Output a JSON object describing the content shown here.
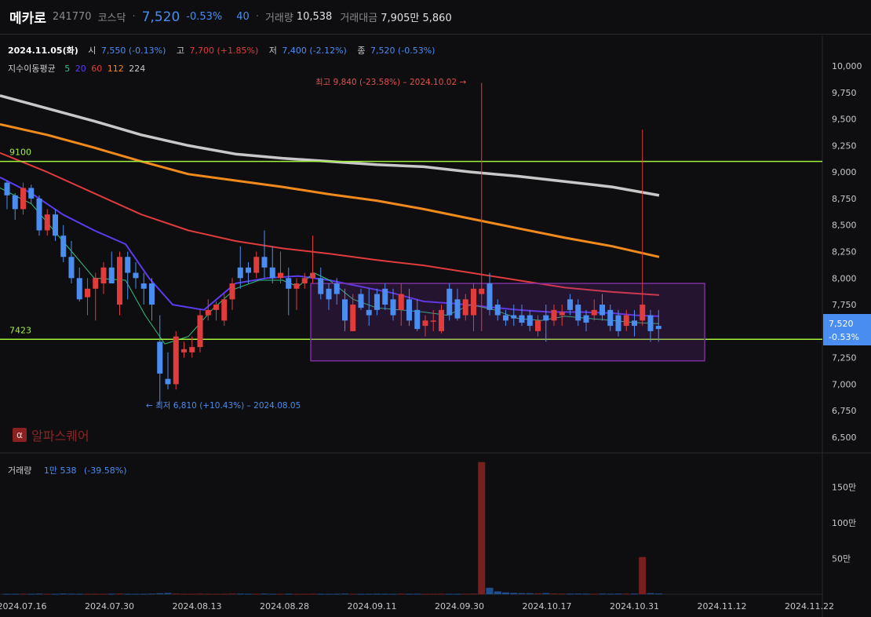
{
  "header": {
    "name": "메카로",
    "code": "241770",
    "market": "코스닥",
    "separator": "·",
    "price": "7,520",
    "change_pct": "-0.53%",
    "change_abs": "40",
    "volume_label": "거래량",
    "volume_value": "10,538",
    "amount_label": "거래대금",
    "amount_value": "7,905만 5,860"
  },
  "ohlc": {
    "date": "2024.11.05(화)",
    "open_label": "시",
    "open_value": "7,550 (-0.13%)",
    "high_label": "고",
    "high_value": "7,700 (+1.85%)",
    "low_label": "저",
    "low_value": "7,400 (-2.12%)",
    "close_label": "종",
    "close_value": "7,520 (-0.53%)"
  },
  "ma_legend": {
    "label": "지수이동평균",
    "periods": [
      "5",
      "20",
      "60",
      "112",
      "224"
    ]
  },
  "volume_info": {
    "label": "거래량",
    "value": "1만 538",
    "change": "(-39.58%)"
  },
  "watermark": {
    "glyph": "α",
    "text": "알파스퀘어"
  },
  "colors": {
    "up": "#e03c3c",
    "down": "#4a8df0",
    "up_volume": "#7a1f1f",
    "down_volume": "#1f4f8f",
    "ma5": "#2ec27e",
    "ma20": "#5b3cf0",
    "ma60": "#e03c3c",
    "ma112": "#f08a1c",
    "ma224": "#c8c8c8",
    "hline": "#a4f03c",
    "box": "#7b2fa0",
    "price_tag": "#4a8df0"
  },
  "chart_data": {
    "type": "candlestick",
    "y_axis_ticks": [
      "10,000",
      "9,750",
      "9,500",
      "9,250",
      "9,000",
      "8,750",
      "8,500",
      "8,250",
      "8,000",
      "7,750",
      "7,500",
      "7,250",
      "7,000",
      "6,750",
      "6,500"
    ],
    "ylim": [
      6400,
      10200
    ],
    "volume_axis_ticks": [
      "150만",
      "100만",
      "50만"
    ],
    "x_axis_ticks": [
      "2024.07.16",
      "2024.07.30",
      "2024.08.13",
      "2024.08.28",
      "2024.09.11",
      "2024.09.30",
      "2024.10.17",
      "2024.10.31",
      "2024.11.12",
      "2024.11.22"
    ],
    "last_price_tag": {
      "price": "7,520",
      "change": "-0.53%"
    },
    "horizontal_lines": [
      {
        "label": "9100",
        "value": 9100
      },
      {
        "label": "7423",
        "value": 7423
      }
    ],
    "annotations": {
      "high": "최고 9,840 (-23.58%) – 2024.10.02 →",
      "low": "← 최저 6,810 (+10.43%) – 2024.08.05"
    },
    "range_box": {
      "price_top": 7950,
      "price_bottom": 7220
    },
    "candles": [
      [
        8900,
        8920,
        8650,
        8780
      ],
      [
        8780,
        8800,
        8550,
        8650
      ],
      [
        8650,
        8900,
        8600,
        8850
      ],
      [
        8850,
        8880,
        8700,
        8750
      ],
      [
        8750,
        8780,
        8400,
        8450
      ],
      [
        8450,
        8650,
        8400,
        8600
      ],
      [
        8600,
        8650,
        8350,
        8400
      ],
      [
        8400,
        8500,
        8150,
        8200
      ],
      [
        8200,
        8350,
        7950,
        8000
      ],
      [
        8000,
        8100,
        7780,
        7800
      ],
      [
        7820,
        8000,
        7650,
        7900
      ],
      [
        7900,
        8050,
        7600,
        8000
      ],
      [
        7950,
        8150,
        7850,
        8100
      ],
      [
        8100,
        8250,
        7950,
        7950
      ],
      [
        7750,
        8250,
        7650,
        8200
      ],
      [
        8200,
        8250,
        7800,
        8050
      ],
      [
        8050,
        8150,
        7900,
        8000
      ],
      [
        7950,
        8050,
        7750,
        7900
      ],
      [
        7950,
        8000,
        7600,
        7750
      ],
      [
        7400,
        7650,
        6810,
        7100
      ],
      [
        7050,
        7300,
        6950,
        7000
      ],
      [
        7000,
        7500,
        6950,
        7450
      ],
      [
        7300,
        7400,
        7250,
        7330
      ],
      [
        7300,
        7450,
        7250,
        7350
      ],
      [
        7350,
        7700,
        7300,
        7650
      ],
      [
        7650,
        7800,
        7600,
        7700
      ],
      [
        7700,
        7780,
        7600,
        7750
      ],
      [
        7600,
        7850,
        7550,
        7800
      ],
      [
        7800,
        8000,
        7700,
        7950
      ],
      [
        8100,
        8300,
        7900,
        8000
      ],
      [
        8100,
        8150,
        7950,
        8050
      ],
      [
        8050,
        8250,
        8000,
        8200
      ],
      [
        8200,
        8450,
        8000,
        8100
      ],
      [
        8100,
        8300,
        7950,
        8000
      ],
      [
        8000,
        8250,
        7950,
        8050
      ],
      [
        8000,
        8100,
        7650,
        7900
      ],
      [
        7900,
        8000,
        7700,
        7950
      ],
      [
        7950,
        8050,
        7900,
        8000
      ],
      [
        8000,
        8400,
        7950,
        8050
      ],
      [
        8000,
        8100,
        7800,
        7850
      ],
      [
        7900,
        7950,
        7700,
        7800
      ],
      [
        7950,
        8000,
        7750,
        7850
      ],
      [
        7800,
        7900,
        7500,
        7600
      ],
      [
        7500,
        7850,
        7500,
        7750
      ],
      [
        7850,
        7900,
        7700,
        7720
      ],
      [
        7700,
        7900,
        7550,
        7650
      ],
      [
        7850,
        7900,
        7650,
        7700
      ],
      [
        7900,
        7950,
        7700,
        7750
      ],
      [
        7800,
        7900,
        7600,
        7650
      ],
      [
        7700,
        7950,
        7550,
        7850
      ],
      [
        7800,
        7900,
        7550,
        7600
      ],
      [
        7700,
        7800,
        7500,
        7520
      ],
      [
        7550,
        7650,
        7450,
        7600
      ],
      [
        7600,
        7700,
        7500,
        7600
      ],
      [
        7500,
        7750,
        7480,
        7700
      ],
      [
        7900,
        7950,
        7600,
        7650
      ],
      [
        7800,
        7900,
        7600,
        7620
      ],
      [
        7650,
        7850,
        7600,
        7800
      ],
      [
        7650,
        7950,
        7500,
        7900
      ],
      [
        7850,
        9840,
        7500,
        7900
      ],
      [
        7950,
        8050,
        7650,
        7700
      ],
      [
        7750,
        7800,
        7600,
        7650
      ],
      [
        7650,
        7700,
        7550,
        7600
      ],
      [
        7650,
        7750,
        7550,
        7620
      ],
      [
        7650,
        7750,
        7550,
        7580
      ],
      [
        7650,
        7700,
        7500,
        7550
      ],
      [
        7500,
        7650,
        7450,
        7600
      ],
      [
        7650,
        7750,
        7400,
        7600
      ],
      [
        7600,
        7750,
        7550,
        7700
      ],
      [
        7650,
        7750,
        7550,
        7680
      ],
      [
        7800,
        7850,
        7650,
        7700
      ],
      [
        7750,
        7800,
        7550,
        7600
      ],
      [
        7650,
        7700,
        7500,
        7580
      ],
      [
        7650,
        7800,
        7600,
        7700
      ],
      [
        7750,
        7850,
        7600,
        7650
      ],
      [
        7700,
        7750,
        7500,
        7550
      ],
      [
        7650,
        7700,
        7450,
        7500
      ],
      [
        7550,
        7700,
        7500,
        7650
      ],
      [
        7600,
        7700,
        7450,
        7550
      ],
      [
        7600,
        9400,
        7550,
        7750
      ],
      [
        7650,
        7700,
        7400,
        7500
      ],
      [
        7550,
        7700,
        7400,
        7520
      ]
    ],
    "volumes": [
      6000,
      5000,
      7000,
      5500,
      8000,
      6000,
      5000,
      9000,
      7000,
      6000,
      5500,
      6000,
      5000,
      7000,
      9000,
      6000,
      5000,
      6000,
      8000,
      14000,
      18000,
      9000,
      6000,
      6000,
      8000,
      6000,
      5000,
      6000,
      9000,
      8000,
      6000,
      7000,
      8000,
      6000,
      6000,
      7000,
      5000,
      5000,
      7000,
      6000,
      5000,
      6000,
      8000,
      6000,
      5000,
      6000,
      7000,
      6000,
      5000,
      8000,
      6000,
      7000,
      5000,
      6000,
      7000,
      6000,
      6000,
      7000,
      9000,
      1850000,
      90000,
      40000,
      25000,
      18000,
      15000,
      14000,
      12000,
      16000,
      10000,
      9000,
      8000,
      9000,
      8000,
      7000,
      8000,
      7000,
      9000,
      8000,
      9000,
      520000,
      15000,
      10538
    ],
    "ema_series": [
      {
        "name": "224",
        "width": 3.5,
        "values": [
          [
            0,
            9720
          ],
          [
            60,
            9600
          ],
          [
            120,
            9480
          ],
          [
            180,
            9350
          ],
          [
            240,
            9250
          ],
          [
            300,
            9170
          ],
          [
            360,
            9130
          ],
          [
            420,
            9100
          ],
          [
            480,
            9070
          ],
          [
            540,
            9050
          ],
          [
            600,
            9000
          ],
          [
            660,
            8960
          ],
          [
            720,
            8910
          ],
          [
            780,
            8860
          ],
          [
            840,
            8780
          ]
        ]
      },
      {
        "name": "112",
        "width": 3,
        "values": [
          [
            0,
            9450
          ],
          [
            60,
            9350
          ],
          [
            120,
            9230
          ],
          [
            180,
            9100
          ],
          [
            240,
            8980
          ],
          [
            300,
            8920
          ],
          [
            360,
            8860
          ],
          [
            420,
            8790
          ],
          [
            480,
            8730
          ],
          [
            540,
            8650
          ],
          [
            600,
            8560
          ],
          [
            660,
            8470
          ],
          [
            720,
            8380
          ],
          [
            780,
            8300
          ],
          [
            840,
            8200
          ]
        ]
      },
      {
        "name": "60",
        "width": 2,
        "values": [
          [
            0,
            9180
          ],
          [
            60,
            9000
          ],
          [
            120,
            8800
          ],
          [
            180,
            8600
          ],
          [
            240,
            8450
          ],
          [
            300,
            8350
          ],
          [
            360,
            8280
          ],
          [
            420,
            8230
          ],
          [
            480,
            8170
          ],
          [
            540,
            8120
          ],
          [
            600,
            8050
          ],
          [
            660,
            7980
          ],
          [
            720,
            7910
          ],
          [
            780,
            7870
          ],
          [
            840,
            7840
          ]
        ]
      },
      {
        "name": "20",
        "width": 2,
        "values": [
          [
            0,
            8950
          ],
          [
            40,
            8800
          ],
          [
            80,
            8600
          ],
          [
            120,
            8450
          ],
          [
            160,
            8320
          ],
          [
            190,
            8000
          ],
          [
            220,
            7750
          ],
          [
            260,
            7700
          ],
          [
            300,
            7950
          ],
          [
            340,
            8000
          ],
          [
            380,
            8020
          ],
          [
            420,
            7980
          ],
          [
            460,
            7920
          ],
          [
            500,
            7860
          ],
          [
            540,
            7780
          ],
          [
            580,
            7760
          ],
          [
            620,
            7730
          ],
          [
            660,
            7700
          ],
          [
            700,
            7680
          ],
          [
            740,
            7680
          ],
          [
            780,
            7670
          ],
          [
            810,
            7650
          ],
          [
            840,
            7640
          ]
        ]
      },
      {
        "name": "5",
        "width": 1,
        "values": [
          [
            0,
            8850
          ],
          [
            40,
            8700
          ],
          [
            80,
            8350
          ],
          [
            120,
            8000
          ],
          [
            160,
            7980
          ],
          [
            185,
            7650
          ],
          [
            210,
            7380
          ],
          [
            240,
            7450
          ],
          [
            270,
            7700
          ],
          [
            300,
            7900
          ],
          [
            330,
            7980
          ],
          [
            360,
            7980
          ],
          [
            380,
            7920
          ],
          [
            400,
            8050
          ],
          [
            420,
            7980
          ],
          [
            450,
            7800
          ],
          [
            480,
            7720
          ],
          [
            510,
            7700
          ],
          [
            540,
            7680
          ],
          [
            570,
            7650
          ],
          [
            600,
            7750
          ],
          [
            630,
            7700
          ],
          [
            660,
            7620
          ],
          [
            690,
            7600
          ],
          [
            720,
            7640
          ],
          [
            750,
            7620
          ],
          [
            780,
            7600
          ],
          [
            810,
            7580
          ],
          [
            840,
            7570
          ]
        ]
      }
    ]
  }
}
